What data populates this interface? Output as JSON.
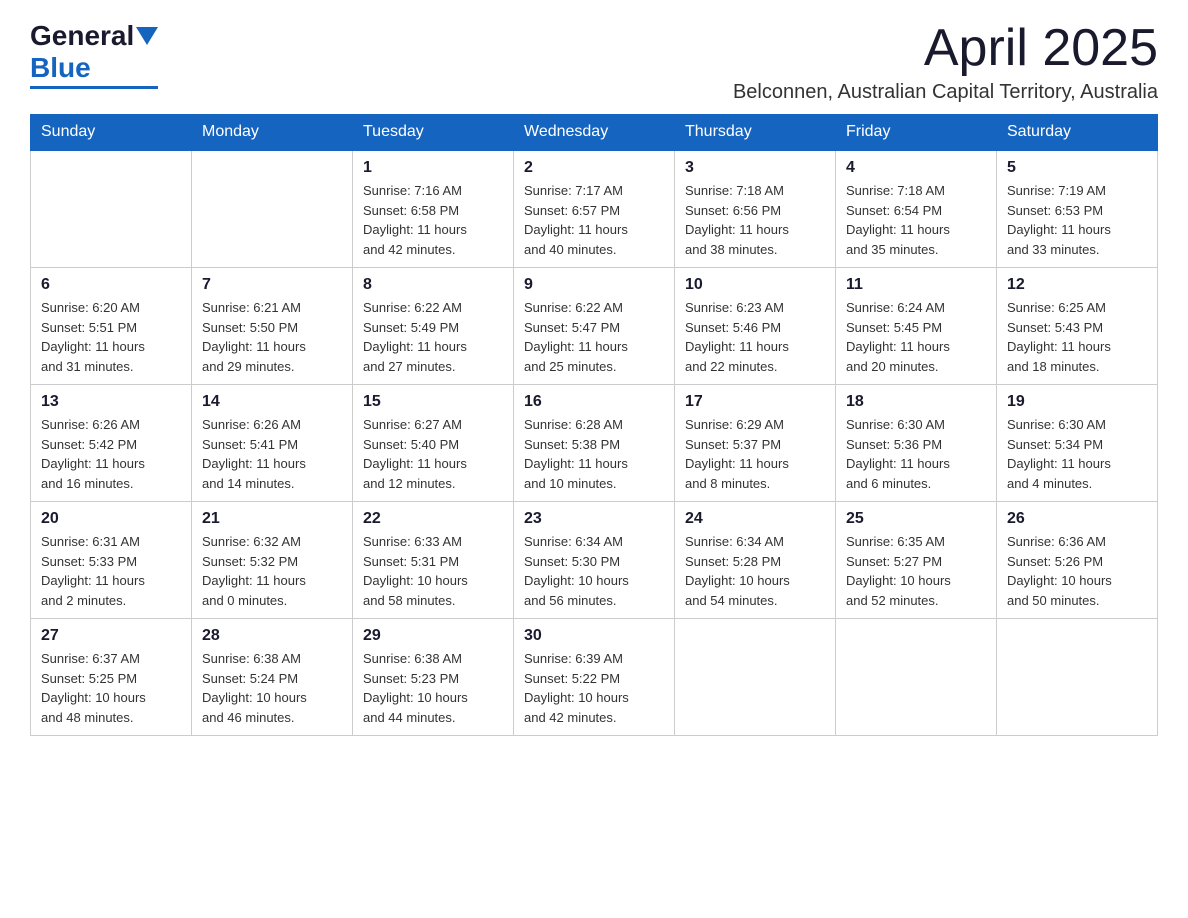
{
  "header": {
    "logo": {
      "general": "General",
      "blue": "Blue"
    },
    "title": "April 2025",
    "subtitle": "Belconnen, Australian Capital Territory, Australia"
  },
  "weekdays": [
    "Sunday",
    "Monday",
    "Tuesday",
    "Wednesday",
    "Thursday",
    "Friday",
    "Saturday"
  ],
  "weeks": [
    [
      {
        "day": "",
        "info": ""
      },
      {
        "day": "",
        "info": ""
      },
      {
        "day": "1",
        "info": "Sunrise: 7:16 AM\nSunset: 6:58 PM\nDaylight: 11 hours\nand 42 minutes."
      },
      {
        "day": "2",
        "info": "Sunrise: 7:17 AM\nSunset: 6:57 PM\nDaylight: 11 hours\nand 40 minutes."
      },
      {
        "day": "3",
        "info": "Sunrise: 7:18 AM\nSunset: 6:56 PM\nDaylight: 11 hours\nand 38 minutes."
      },
      {
        "day": "4",
        "info": "Sunrise: 7:18 AM\nSunset: 6:54 PM\nDaylight: 11 hours\nand 35 minutes."
      },
      {
        "day": "5",
        "info": "Sunrise: 7:19 AM\nSunset: 6:53 PM\nDaylight: 11 hours\nand 33 minutes."
      }
    ],
    [
      {
        "day": "6",
        "info": "Sunrise: 6:20 AM\nSunset: 5:51 PM\nDaylight: 11 hours\nand 31 minutes."
      },
      {
        "day": "7",
        "info": "Sunrise: 6:21 AM\nSunset: 5:50 PM\nDaylight: 11 hours\nand 29 minutes."
      },
      {
        "day": "8",
        "info": "Sunrise: 6:22 AM\nSunset: 5:49 PM\nDaylight: 11 hours\nand 27 minutes."
      },
      {
        "day": "9",
        "info": "Sunrise: 6:22 AM\nSunset: 5:47 PM\nDaylight: 11 hours\nand 25 minutes."
      },
      {
        "day": "10",
        "info": "Sunrise: 6:23 AM\nSunset: 5:46 PM\nDaylight: 11 hours\nand 22 minutes."
      },
      {
        "day": "11",
        "info": "Sunrise: 6:24 AM\nSunset: 5:45 PM\nDaylight: 11 hours\nand 20 minutes."
      },
      {
        "day": "12",
        "info": "Sunrise: 6:25 AM\nSunset: 5:43 PM\nDaylight: 11 hours\nand 18 minutes."
      }
    ],
    [
      {
        "day": "13",
        "info": "Sunrise: 6:26 AM\nSunset: 5:42 PM\nDaylight: 11 hours\nand 16 minutes."
      },
      {
        "day": "14",
        "info": "Sunrise: 6:26 AM\nSunset: 5:41 PM\nDaylight: 11 hours\nand 14 minutes."
      },
      {
        "day": "15",
        "info": "Sunrise: 6:27 AM\nSunset: 5:40 PM\nDaylight: 11 hours\nand 12 minutes."
      },
      {
        "day": "16",
        "info": "Sunrise: 6:28 AM\nSunset: 5:38 PM\nDaylight: 11 hours\nand 10 minutes."
      },
      {
        "day": "17",
        "info": "Sunrise: 6:29 AM\nSunset: 5:37 PM\nDaylight: 11 hours\nand 8 minutes."
      },
      {
        "day": "18",
        "info": "Sunrise: 6:30 AM\nSunset: 5:36 PM\nDaylight: 11 hours\nand 6 minutes."
      },
      {
        "day": "19",
        "info": "Sunrise: 6:30 AM\nSunset: 5:34 PM\nDaylight: 11 hours\nand 4 minutes."
      }
    ],
    [
      {
        "day": "20",
        "info": "Sunrise: 6:31 AM\nSunset: 5:33 PM\nDaylight: 11 hours\nand 2 minutes."
      },
      {
        "day": "21",
        "info": "Sunrise: 6:32 AM\nSunset: 5:32 PM\nDaylight: 11 hours\nand 0 minutes."
      },
      {
        "day": "22",
        "info": "Sunrise: 6:33 AM\nSunset: 5:31 PM\nDaylight: 10 hours\nand 58 minutes."
      },
      {
        "day": "23",
        "info": "Sunrise: 6:34 AM\nSunset: 5:30 PM\nDaylight: 10 hours\nand 56 minutes."
      },
      {
        "day": "24",
        "info": "Sunrise: 6:34 AM\nSunset: 5:28 PM\nDaylight: 10 hours\nand 54 minutes."
      },
      {
        "day": "25",
        "info": "Sunrise: 6:35 AM\nSunset: 5:27 PM\nDaylight: 10 hours\nand 52 minutes."
      },
      {
        "day": "26",
        "info": "Sunrise: 6:36 AM\nSunset: 5:26 PM\nDaylight: 10 hours\nand 50 minutes."
      }
    ],
    [
      {
        "day": "27",
        "info": "Sunrise: 6:37 AM\nSunset: 5:25 PM\nDaylight: 10 hours\nand 48 minutes."
      },
      {
        "day": "28",
        "info": "Sunrise: 6:38 AM\nSunset: 5:24 PM\nDaylight: 10 hours\nand 46 minutes."
      },
      {
        "day": "29",
        "info": "Sunrise: 6:38 AM\nSunset: 5:23 PM\nDaylight: 10 hours\nand 44 minutes."
      },
      {
        "day": "30",
        "info": "Sunrise: 6:39 AM\nSunset: 5:22 PM\nDaylight: 10 hours\nand 42 minutes."
      },
      {
        "day": "",
        "info": ""
      },
      {
        "day": "",
        "info": ""
      },
      {
        "day": "",
        "info": ""
      }
    ]
  ]
}
